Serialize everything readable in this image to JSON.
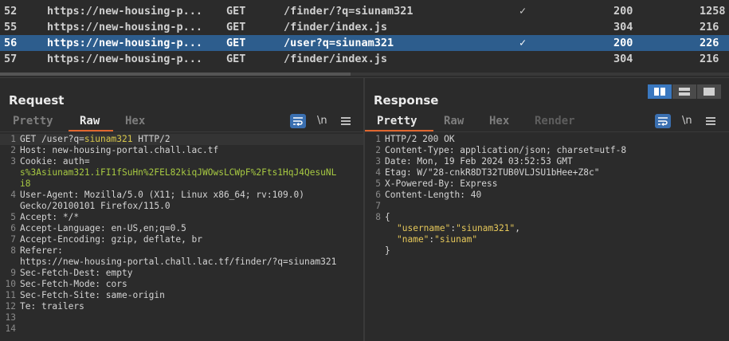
{
  "history": {
    "rows": [
      {
        "num": "52",
        "host": "https://new-housing-p...",
        "method": "GET",
        "url": "/finder/?q=siunam321",
        "check": "✓",
        "status": "200",
        "length": "1258",
        "selected": false
      },
      {
        "num": "55",
        "host": "https://new-housing-p...",
        "method": "GET",
        "url": "/finder/index.js",
        "check": "",
        "status": "304",
        "length": "216",
        "selected": false
      },
      {
        "num": "56",
        "host": "https://new-housing-p...",
        "method": "GET",
        "url": "/user?q=siunam321",
        "check": "✓",
        "status": "200",
        "length": "226",
        "selected": true
      },
      {
        "num": "57",
        "host": "https://new-housing-p...",
        "method": "GET",
        "url": "/finder/index.js",
        "check": "",
        "status": "304",
        "length": "216",
        "selected": false
      }
    ]
  },
  "request": {
    "title": "Request",
    "tabs": {
      "pretty": "Pretty",
      "raw": "Raw",
      "hex": "Hex"
    },
    "newline_label": "\\n",
    "lines": {
      "l1_method": "GET /user?q=",
      "l1_param": "siunam321",
      "l1_proto": " HTTP/2",
      "l2_key": "Host:",
      "l2_val": " new-housing-portal.chall.lac.tf",
      "l3_key": "Cookie:",
      "l3_val": " auth=",
      "l3b": "s%3Asiunam321.iFI1fSuHn%2FEL82kiqJWOwsLCWpF%2Fts1HqJ4QesuNL",
      "l3c": "i8",
      "l4_key": "User-Agent:",
      "l4_val": " Mozilla/5.0 (X11; Linux x86_64; rv:109.0)",
      "l4b": "Gecko/20100101 Firefox/115.0",
      "l5_key": "Accept:",
      "l5_val": " */*",
      "l6_key": "Accept-Language:",
      "l6_val": " en-US,en;q=0.5",
      "l7_key": "Accept-Encoding:",
      "l7_val": " gzip, deflate, br",
      "l8_key": "Referer:",
      "l8b": "https://new-housing-portal.chall.lac.tf/finder/?q=siunam321",
      "l9_key": "Sec-Fetch-Dest:",
      "l9_val": " empty",
      "l10_key": "Sec-Fetch-Mode:",
      "l10_val": " cors",
      "l11_key": "Sec-Fetch-Site:",
      "l11_val": " same-origin",
      "l12_key": "Te:",
      "l12_val": " trailers"
    },
    "line_numbers": [
      "1",
      "2",
      "3",
      "4",
      "5",
      "6",
      "7",
      "8",
      "9",
      "10",
      "11",
      "12",
      "13",
      "14"
    ]
  },
  "response": {
    "title": "Response",
    "tabs": {
      "pretty": "Pretty",
      "raw": "Raw",
      "hex": "Hex",
      "render": "Render"
    },
    "newline_label": "\\n",
    "lines": {
      "l1": "HTTP/2 200 OK",
      "l2_key": "Content-Type:",
      "l2_val": " application/json; charset=utf-8",
      "l3_key": "Date:",
      "l3_val": " Mon, 19 Feb 2024 03:52:53 GMT",
      "l4_key": "Etag:",
      "l4_val": " W/\"28-cnkR8DT32TUB0VLJSU1bHee+Z8c\"",
      "l5_key": "X-Powered-By:",
      "l5_val": " Express",
      "l6_key": "Content-Length:",
      "l6_val": " 40",
      "l8": "{",
      "j1_key": "\"username\"",
      "j1_sep": ":",
      "j1_val": "\"siunam321\"",
      "j1_end": ",",
      "j2_key": "\"name\"",
      "j2_sep": ":",
      "j2_val": "\"siunam\"",
      "l9": "}"
    },
    "line_numbers": [
      "1",
      "2",
      "3",
      "4",
      "5",
      "6",
      "7",
      "8"
    ]
  },
  "colors": {
    "accent_tab": "#e0662f",
    "selected_row": "#2d5d8d",
    "tool_active": "#3a6fb0",
    "param_value": "#d8c84a",
    "cookie_value": "#a7c942"
  },
  "icons": {
    "wrap": "word-wrap-icon",
    "menu": "hamburger-menu-icon",
    "layout_split": "split-columns-icon",
    "layout_rows": "split-rows-icon",
    "layout_single": "single-pane-icon"
  }
}
